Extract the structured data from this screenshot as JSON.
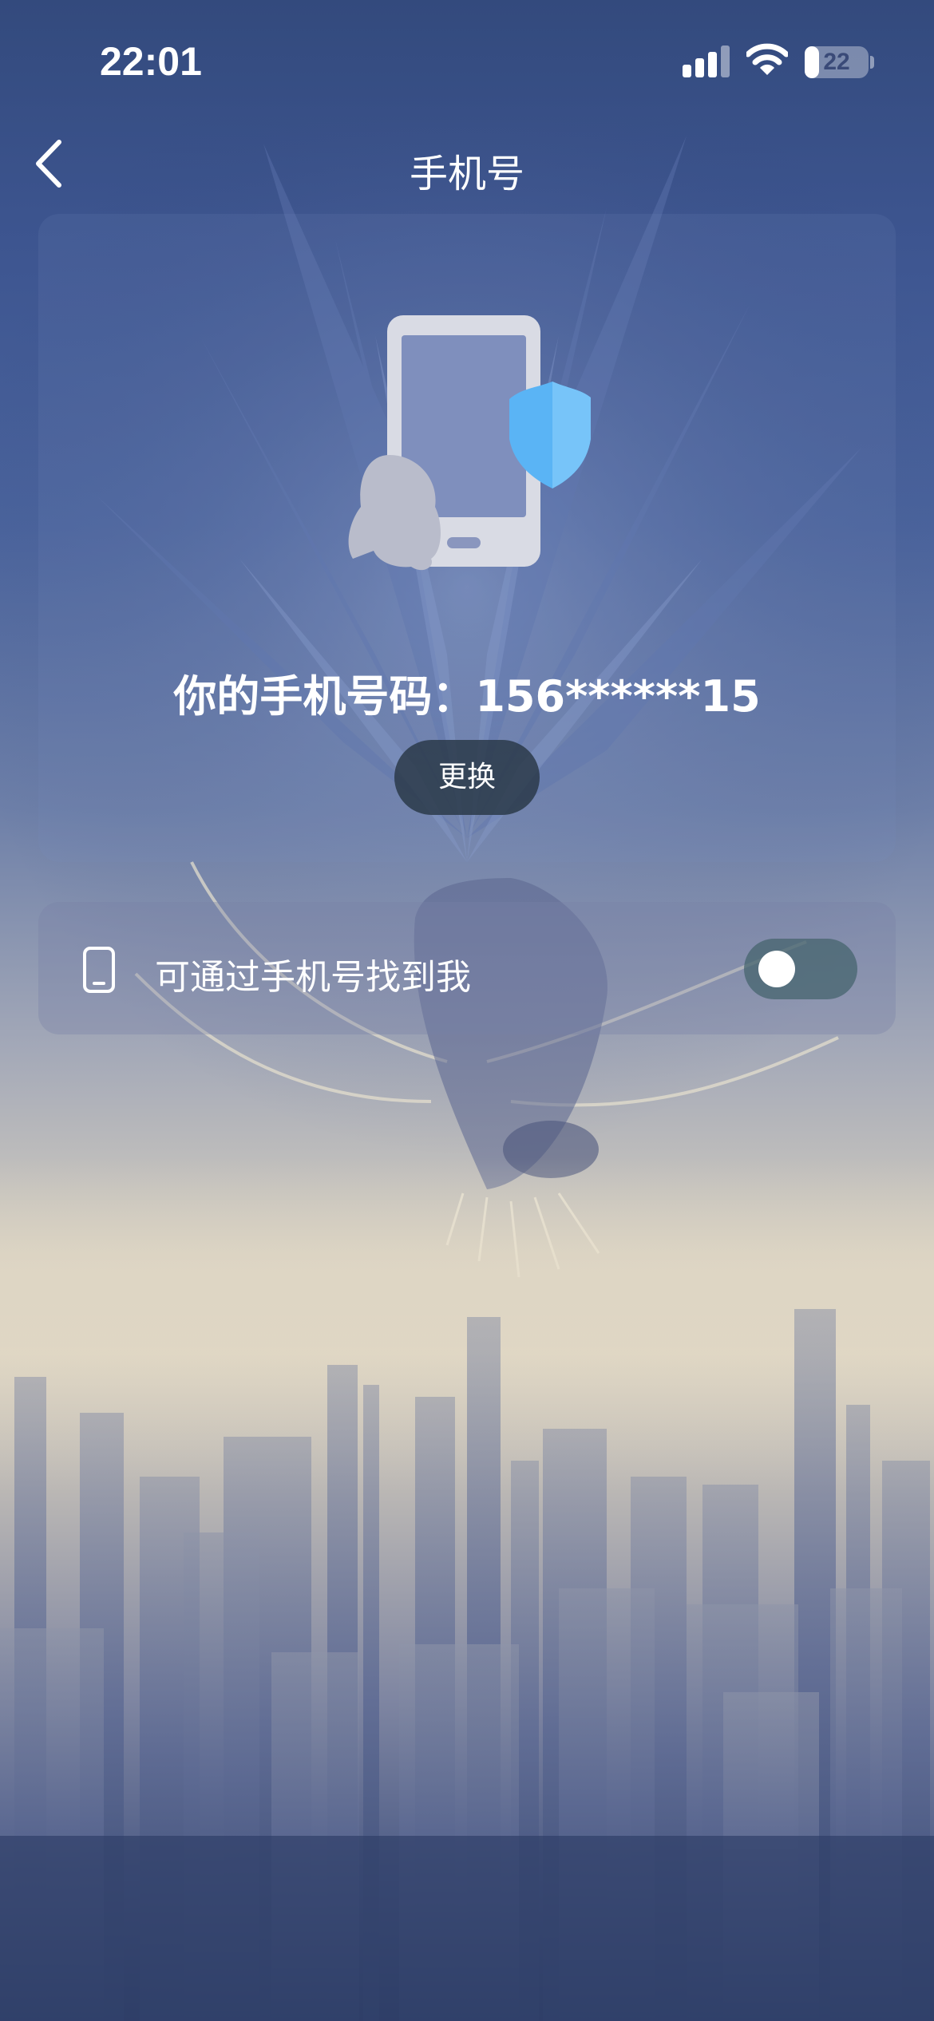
{
  "status_bar": {
    "time": "22:01",
    "battery_level": "22",
    "icons": [
      "signal-icon",
      "wifi-icon",
      "battery-icon"
    ]
  },
  "nav": {
    "title": "手机号",
    "back_icon": "chevron-left-icon"
  },
  "phone_card": {
    "illustration": "phone-shield-penguin-illustration",
    "number_line": "你的手机号码：156******15",
    "change_button": "更换"
  },
  "settings": {
    "find_by_phone": {
      "icon": "mobile-phone-icon",
      "label": "可通过手机号找到我",
      "enabled": false
    }
  },
  "colors": {
    "card_bg": "#788cbe",
    "button_bg": "#283746",
    "toggle_off": "#46646e",
    "shield_blue": "#5ab4f5"
  }
}
